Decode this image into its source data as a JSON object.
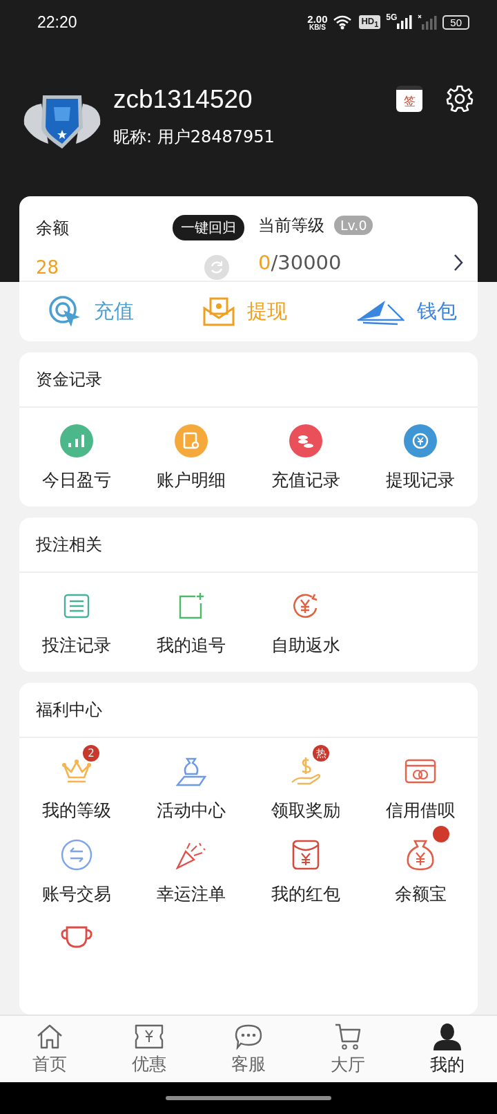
{
  "status_bar": {
    "time": "22:20",
    "speed": "2.00",
    "speed_unit": "KB/S",
    "hd": "HD$_{1}$",
    "network": "5G",
    "battery": "50"
  },
  "profile": {
    "username": "zcb1314520",
    "nickname": "昵称: 用户28487951",
    "sign_in": "签"
  },
  "account": {
    "balance_label": "余额",
    "balance": "28",
    "recall_button": "一键回归",
    "level_label": "当前等级",
    "level_badge": "Lv.0",
    "points": "0",
    "points_target": "/30000",
    "actions": [
      {
        "kind": "target",
        "label": "充值",
        "color": "#4a9fd0"
      },
      {
        "kind": "envelope",
        "label": "提现",
        "color": "#f0a020"
      },
      {
        "kind": "plane",
        "label": "钱包",
        "color": "#3a86e0"
      }
    ]
  },
  "sections": [
    {
      "title": "资金记录",
      "items": [
        {
          "kind": "chart",
          "label": "今日盈亏"
        },
        {
          "kind": "search-doc",
          "label": "账户明细"
        },
        {
          "kind": "coins",
          "label": "充值记录"
        },
        {
          "kind": "yen-circle",
          "label": "提现记录"
        }
      ]
    },
    {
      "title": "投注相关",
      "items": [
        {
          "kind": "list",
          "label": "投注记录"
        },
        {
          "kind": "add-square",
          "label": "我的追号"
        },
        {
          "kind": "yen-refresh",
          "label": "自助返水"
        }
      ]
    },
    {
      "title": "福利中心",
      "items": [
        {
          "kind": "crown",
          "label": "我的等级",
          "badge": "2"
        },
        {
          "kind": "bag-hand",
          "label": "活动中心"
        },
        {
          "kind": "dollar-hand",
          "label": "领取奖励",
          "badge": "热"
        },
        {
          "kind": "card",
          "label": "信用借呗"
        },
        {
          "kind": "swap",
          "label": "账号交易"
        },
        {
          "kind": "party",
          "label": "幸运注单"
        },
        {
          "kind": "red-packet",
          "label": "我的红包"
        },
        {
          "kind": "money-bag",
          "label": "余额宝",
          "dot": true
        },
        {
          "kind": "cup"
        }
      ]
    }
  ],
  "nav": [
    {
      "kind": "home",
      "label": "首页",
      "selected": false
    },
    {
      "kind": "ticket",
      "label": "优惠",
      "selected": false
    },
    {
      "kind": "chat",
      "label": "客服",
      "selected": false
    },
    {
      "kind": "cart",
      "label": "大厅",
      "selected": false
    },
    {
      "kind": "person",
      "label": "我的",
      "selected": true
    }
  ]
}
